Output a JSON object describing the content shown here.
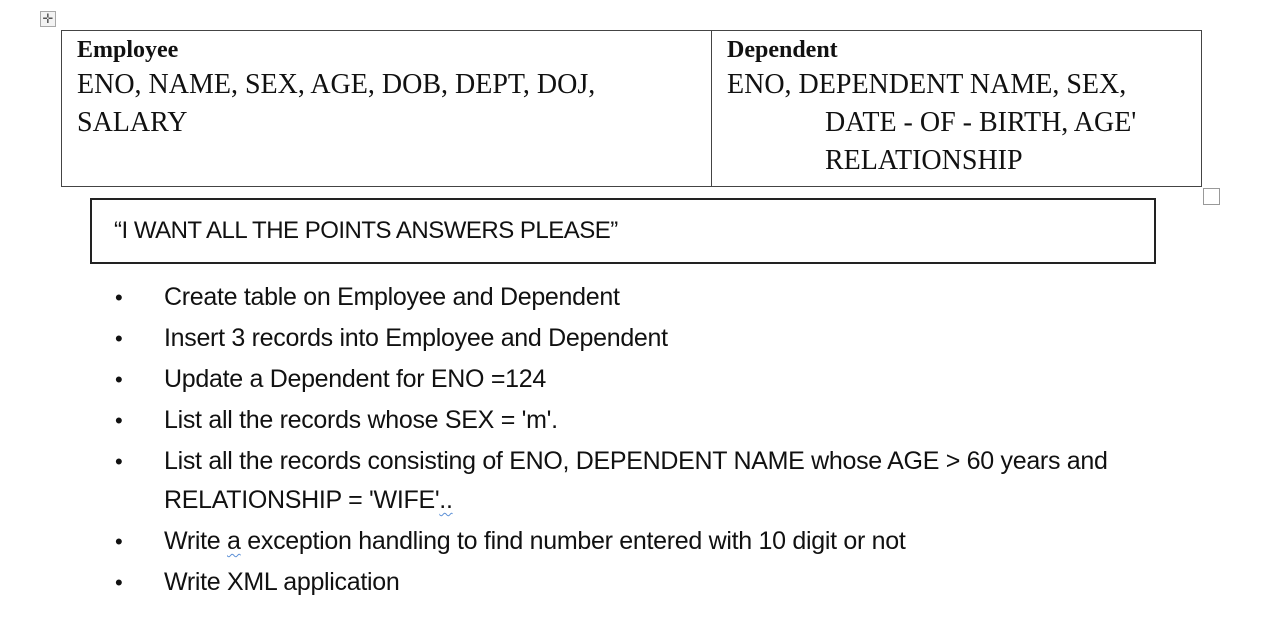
{
  "schema_table": {
    "employee": {
      "title": "Employee",
      "fields_line1": "ENO, NAME, SEX, AGE, DOB, DEPT, DOJ,",
      "fields_line2": "SALARY"
    },
    "dependent": {
      "title": "Dependent",
      "fields_line1": "ENO, DEPENDENT NAME, SEX,",
      "fields_line2": "DATE - OF - BIRTH, AGE'",
      "fields_line3": "RELATIONSHIP"
    }
  },
  "note": {
    "text": "“I WANT ALL THE POINTS ANSWERS PLEASE”"
  },
  "tasks": {
    "bullet": "•",
    "items": [
      {
        "text": "Create table on Employee and Dependent"
      },
      {
        "text": "Insert 3 records into Employee and Dependent"
      },
      {
        "text": "Update a Dependent for ENO =124"
      },
      {
        "text": "List all the records whose SEX = 'm'."
      },
      {
        "text_line1": "List all the records consisting of ENO, DEPENDENT NAME whose AGE > 60 years and",
        "text_line2_pre": "RELATIONSHIP = 'WIFE'",
        "text_line2_flagged": ".."
      },
      {
        "text_pre": "Write ",
        "text_flagged": "a",
        "text_post": " exception handling to find number entered with 10 digit or not"
      },
      {
        "text": "Write XML application"
      }
    ]
  },
  "icons": {
    "move_handle": "✛"
  }
}
